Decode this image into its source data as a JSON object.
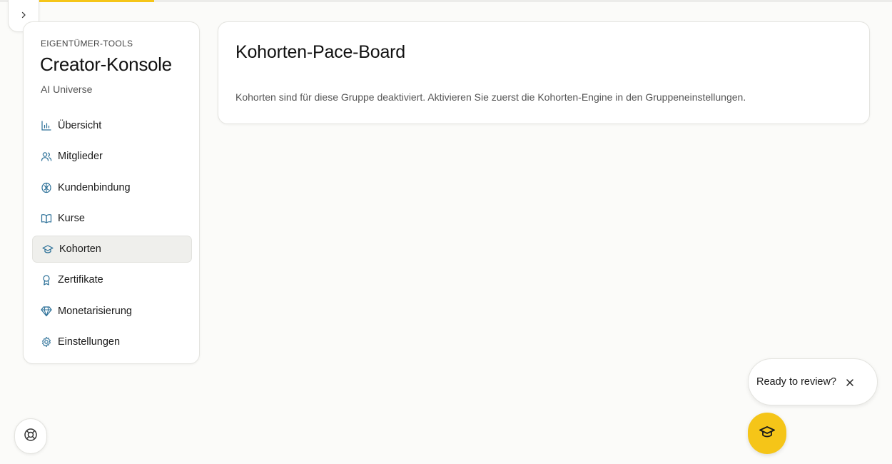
{
  "header": {
    "expand_icon": "chevron-right-icon",
    "accent_color": "#f5c518"
  },
  "sidebar": {
    "eyebrow": "EIGENTÜMER-TOOLS",
    "title": "Creator-Konsole",
    "group": "AI Universe",
    "items": [
      {
        "label": "Übersicht",
        "icon": "bar-chart-icon",
        "active": false
      },
      {
        "label": "Mitglieder",
        "icon": "users-icon",
        "active": false
      },
      {
        "label": "Kundenbindung",
        "icon": "brain-icon",
        "active": false
      },
      {
        "label": "Kurse",
        "icon": "book-open-icon",
        "active": false
      },
      {
        "label": "Kohorten",
        "icon": "graduation-cap-icon",
        "active": true
      },
      {
        "label": "Zertifikate",
        "icon": "award-icon",
        "active": false
      },
      {
        "label": "Monetarisierung",
        "icon": "gem-icon",
        "active": false
      },
      {
        "label": "Einstellungen",
        "icon": "gear-icon",
        "active": false
      }
    ]
  },
  "main": {
    "title": "Kohorten-Pace-Board",
    "description": "Kohorten sind für diese Gruppe deaktiviert. Aktivieren Sie zuerst die Kohorten-Engine in den Gruppeneinstellungen."
  },
  "help": {
    "icon": "lifebuoy-icon"
  },
  "review": {
    "text": "Ready to review?",
    "close_icon": "close-icon",
    "fab_icon": "graduation-cap-icon",
    "fab_color": "#f5c518"
  }
}
